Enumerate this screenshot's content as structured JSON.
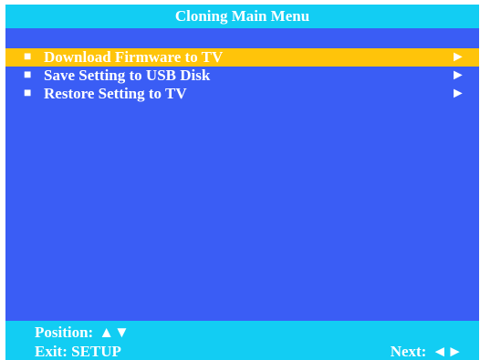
{
  "title": "Cloning Main Menu",
  "menu": {
    "bullet_icon": "square-bullet-icon",
    "arrow_icon": "right-arrow-icon",
    "bullet_glyph": "■",
    "arrow_glyph": "►",
    "selected_index": 0,
    "items": [
      {
        "label": "Download Firmware to TV"
      },
      {
        "label": "Save Setting to USB Disk"
      },
      {
        "label": "Restore Setting to TV"
      }
    ]
  },
  "footer": {
    "position_label": "Position:",
    "position_glyphs": "▲▼",
    "exit_label": "Exit: SETUP",
    "next_label": "Next:",
    "next_glyphs": "◄►"
  },
  "colors": {
    "background": "#3a5df5",
    "bar": "#12cdf3",
    "highlight": "#ffc40a",
    "text": "#ffffff"
  }
}
